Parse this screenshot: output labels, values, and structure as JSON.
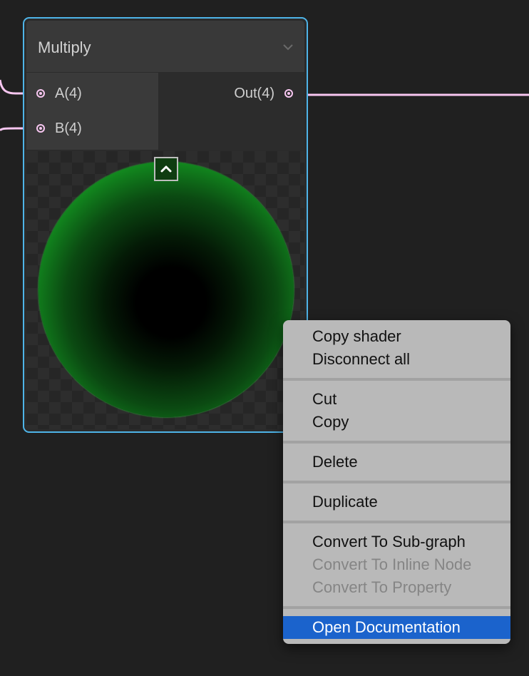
{
  "node": {
    "title": "Multiply",
    "inputs": [
      {
        "label": "A(4)"
      },
      {
        "label": "B(4)"
      }
    ],
    "outputs": [
      {
        "label": "Out(4)"
      }
    ]
  },
  "context_menu": {
    "groups": [
      {
        "items": [
          {
            "label": "Copy shader"
          },
          {
            "label": "Disconnect all"
          }
        ]
      },
      {
        "items": [
          {
            "label": "Cut"
          },
          {
            "label": "Copy"
          }
        ]
      },
      {
        "items": [
          {
            "label": "Delete"
          }
        ]
      },
      {
        "items": [
          {
            "label": "Duplicate"
          }
        ]
      },
      {
        "items": [
          {
            "label": "Convert To Sub-graph"
          },
          {
            "label": "Convert To Inline Node",
            "state": "disabled"
          },
          {
            "label": "Convert To Property",
            "state": "disabled"
          }
        ]
      },
      {
        "items": [
          {
            "label": "Open Documentation",
            "state": "highlighted"
          }
        ]
      }
    ]
  },
  "colors": {
    "background": "#202020",
    "node_selection": "#4eb4e8",
    "wire": "#f7c6f0",
    "menu_highlight": "#1b63cc",
    "preview_green": "#25c935"
  },
  "icons": {
    "collapse": "chevron-down-icon",
    "preview_toggle": "chevron-up-icon",
    "port": "port-dot-icon"
  }
}
